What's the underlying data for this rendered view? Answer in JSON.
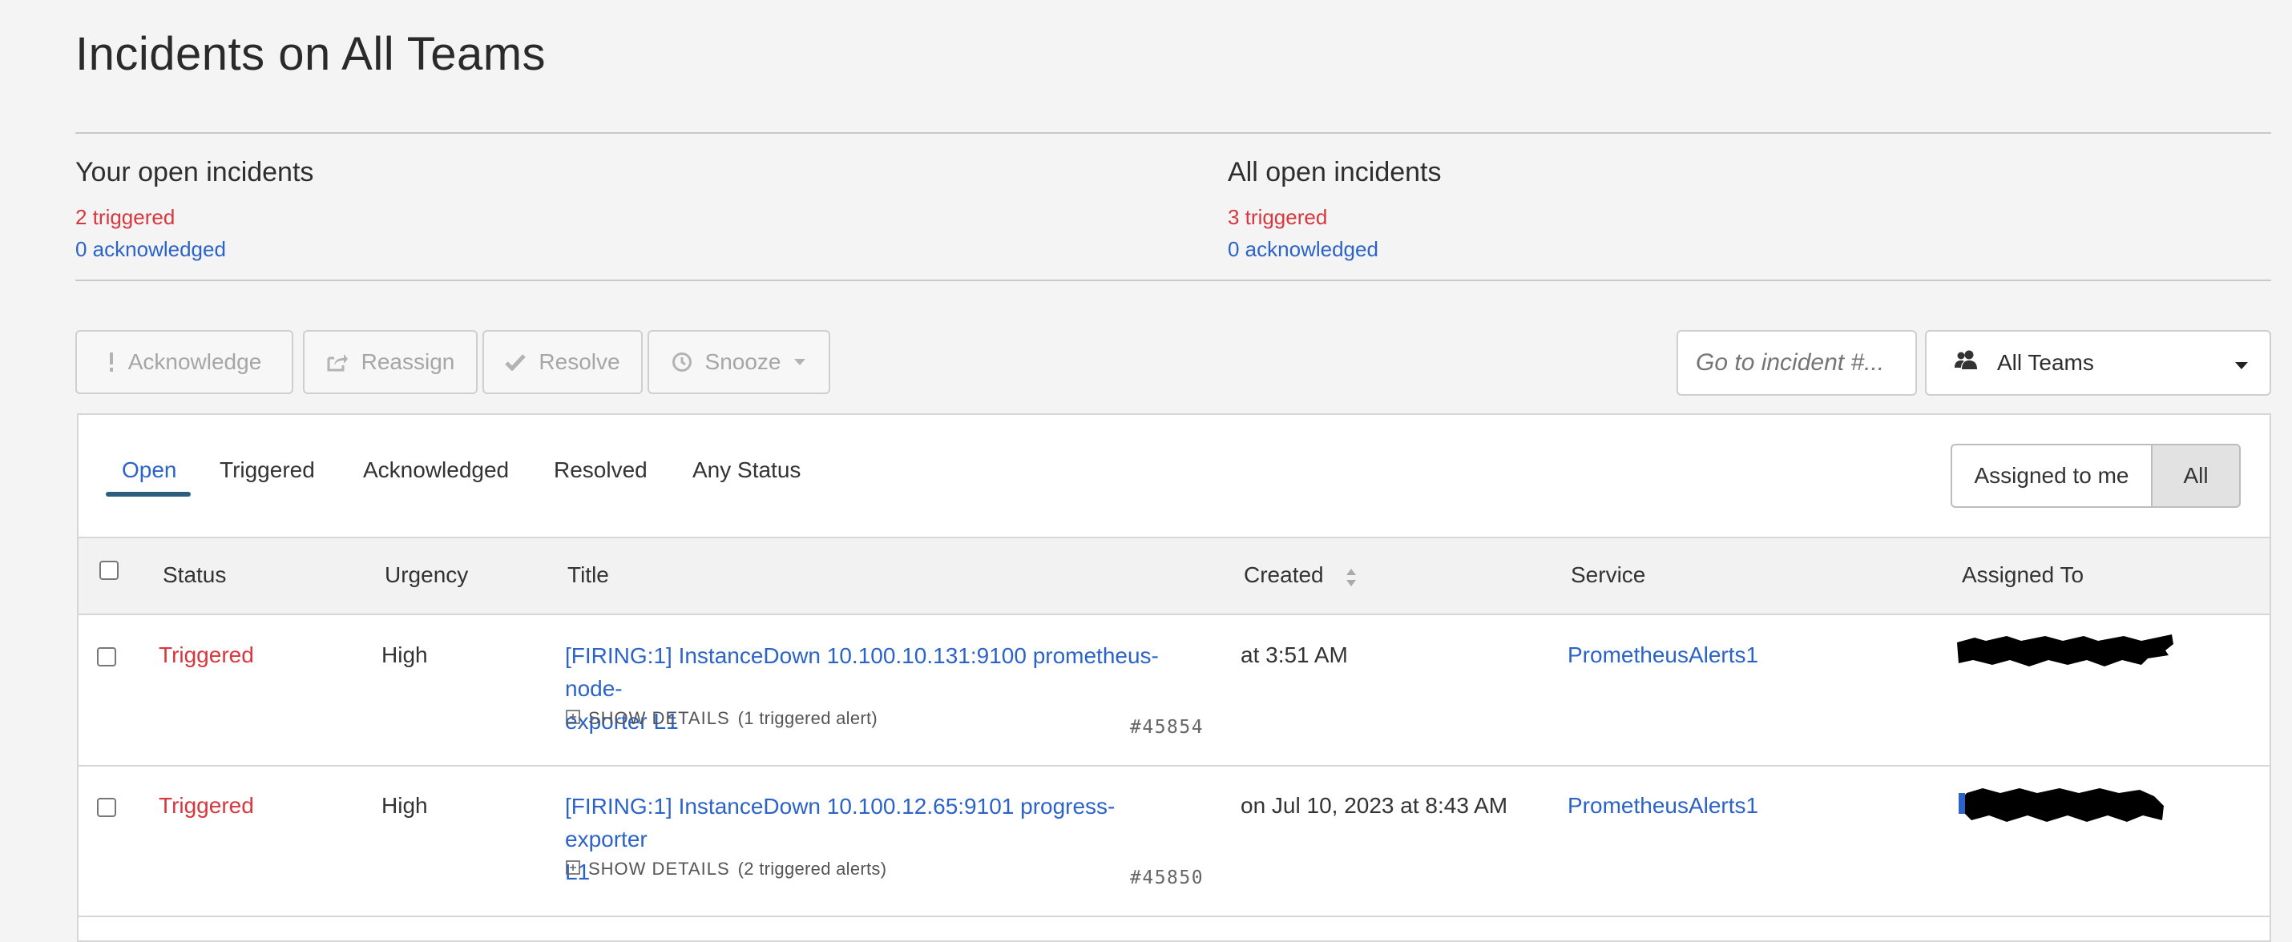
{
  "page": {
    "title": "Incidents on All Teams"
  },
  "summary": {
    "yours": {
      "heading": "Your open incidents",
      "triggered": "2 triggered",
      "acknowledged": "0 acknowledged"
    },
    "all": {
      "heading": "All open incidents",
      "triggered": "3 triggered",
      "acknowledged": "0 acknowledged"
    }
  },
  "toolbar": {
    "acknowledge": "Acknowledge",
    "reassign": "Reassign",
    "resolve": "Resolve",
    "snooze": "Snooze",
    "goto_placeholder": "Go to incident #...",
    "team_selected": "All Teams"
  },
  "tabs": [
    {
      "label": "Open",
      "active": true
    },
    {
      "label": "Triggered"
    },
    {
      "label": "Acknowledged"
    },
    {
      "label": "Resolved"
    },
    {
      "label": "Any Status"
    }
  ],
  "assignment_filter": {
    "assigned_to_me": "Assigned to me",
    "all": "All",
    "selected": "All"
  },
  "table": {
    "columns": [
      "Status",
      "Urgency",
      "Title",
      "Created",
      "Service",
      "Assigned To"
    ],
    "rows": [
      {
        "status": "Triggered",
        "urgency": "High",
        "title_line1": "[FIRING:1] InstanceDown 10.100.10.131:9100 prometheus-node-",
        "title_line2": "exporter L1",
        "details_label": "SHOW DETAILS",
        "details_count": "(1 triggered alert)",
        "incident_number": "#45854",
        "created": "at 3:51 AM",
        "service": "PrometheusAlerts1",
        "assigned_to": "[redacted]"
      },
      {
        "status": "Triggered",
        "urgency": "High",
        "title_line1": "[FIRING:1] InstanceDown 10.100.12.65:9101 progress-exporter",
        "title_line2": "L1",
        "details_label": "SHOW DETAILS",
        "details_count": "(2 triggered alerts)",
        "incident_number": "#45850",
        "created": "on Jul 10, 2023 at 8:43 AM",
        "service": "PrometheusAlerts1",
        "assigned_to": "[redacted]"
      }
    ]
  },
  "icons": {
    "acknowledge": "exclamation-icon",
    "reassign": "share-icon",
    "resolve": "check-icon",
    "snooze": "clock-icon",
    "team": "users-icon",
    "dropdown": "caret-down-icon",
    "sort": "sort-icon",
    "expand": "plus-square-icon"
  },
  "colors": {
    "triggered": "#d9363e",
    "link": "#2b63c8",
    "tab_underline": "#2d5e7e"
  }
}
